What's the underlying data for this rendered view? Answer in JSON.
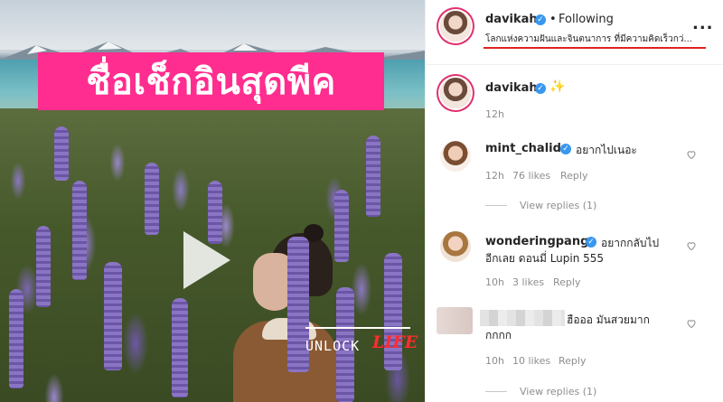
{
  "overlay": {
    "title": "ชื่อเช็กอินสุดพีค",
    "watermark_a": "UNLOCK",
    "watermark_b": "LIFE"
  },
  "header": {
    "username": "davikah",
    "separator": "•",
    "following": "Following",
    "bio": "โลกแห่งความฝันและจินตนาการ ที่มีความคิดเร็วกว่...",
    "more_label": "..."
  },
  "caption": {
    "username": "davikah",
    "emoji": "✨",
    "time": "12h"
  },
  "comments": [
    {
      "username": "mint_chalida",
      "text": "อยากไปเนอะ",
      "time": "12h",
      "likes": "76 likes",
      "reply": "Reply",
      "view_replies": "View replies (1)"
    },
    {
      "username": "wonderingpango",
      "text_line1": "อยากกลับไป",
      "text_line2": "อีกเลย ดอนมี่ Lupin 555",
      "time": "10h",
      "likes": "3 likes",
      "reply": "Reply"
    },
    {
      "username": "",
      "text_line1": "ฮือออ มันสวยมาก",
      "text_line2": "กกกก",
      "time": "10h",
      "likes": "10 likes",
      "reply": "Reply",
      "view_replies": "View replies (1)"
    }
  ],
  "colors": {
    "accent_pink": "#ff2d8f",
    "verified_blue": "#3897f0",
    "underline_red": "#e0211f"
  },
  "icons": {
    "play": "play-icon",
    "verified": "verified-badge-icon",
    "heart": "heart-icon",
    "more": "more-options-icon"
  }
}
